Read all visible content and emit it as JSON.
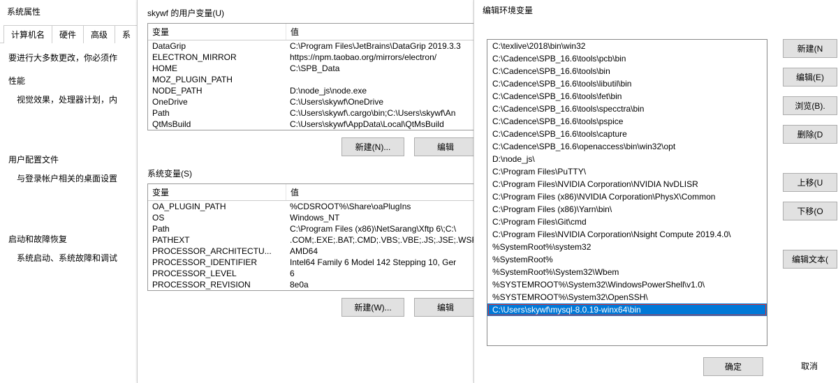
{
  "sysprops": {
    "title": "系统属性",
    "tabs": [
      "计算机名",
      "硬件",
      "高级",
      "系"
    ],
    "active_tab_index": 2,
    "content": {
      "line1": "要进行大多数更改，你必须作",
      "group1_label": "性能",
      "group1_desc": "视觉效果，处理器计划，内",
      "group2_label": "用户配置文件",
      "group2_desc": "与登录帐户相关的桌面设置",
      "group3_label": "启动和故障恢复",
      "group3_desc": "系统启动、系统故障和调试"
    }
  },
  "envvars": {
    "user_section_title": "skywf 的用户变量(U)",
    "sys_section_title": "系统变量(S)",
    "head_var": "变量",
    "head_val": "值",
    "user_vars": [
      {
        "var": "DataGrip",
        "val": "C:\\Program Files\\JetBrains\\DataGrip 2019.3.3"
      },
      {
        "var": "ELECTRON_MIRROR",
        "val": "https://npm.taobao.org/mirrors/electron/"
      },
      {
        "var": "HOME",
        "val": "C:\\SPB_Data"
      },
      {
        "var": "MOZ_PLUGIN_PATH",
        "val": ""
      },
      {
        "var": "NODE_PATH",
        "val": "D:\\node_js\\node.exe"
      },
      {
        "var": "OneDrive",
        "val": "C:\\Users\\skywf\\OneDrive"
      },
      {
        "var": "Path",
        "val": "C:\\Users\\skywf\\.cargo\\bin;C:\\Users\\skywf\\An"
      },
      {
        "var": "QtMsBuild",
        "val": "C:\\Users\\skywf\\AppData\\Local\\QtMsBuild"
      }
    ],
    "sys_vars": [
      {
        "var": "OA_PLUGIN_PATH",
        "val": "%CDSROOT%\\Share\\oaPlugIns"
      },
      {
        "var": "OS",
        "val": "Windows_NT"
      },
      {
        "var": "Path",
        "val": "C:\\Program Files (x86)\\NetSarang\\Xftp 6\\;C:\\"
      },
      {
        "var": "PATHEXT",
        "val": ".COM;.EXE;.BAT;.CMD;.VBS;.VBE;.JS;.JSE;.WSF"
      },
      {
        "var": "PROCESSOR_ARCHITECTU...",
        "val": "AMD64"
      },
      {
        "var": "PROCESSOR_IDENTIFIER",
        "val": "Intel64 Family 6 Model 142 Stepping 10, Ger"
      },
      {
        "var": "PROCESSOR_LEVEL",
        "val": "6"
      },
      {
        "var": "PROCESSOR_REVISION",
        "val": "8e0a"
      }
    ],
    "buttons": {
      "new_user": "新建(N)...",
      "edit_user": "编辑",
      "new_sys": "新建(W)...",
      "edit_sys": "编辑"
    }
  },
  "editvar": {
    "title": "编辑环境变量",
    "items": [
      "C:\\texlive\\2018\\bin\\win32",
      "C:\\Cadence\\SPB_16.6\\tools\\pcb\\bin",
      "C:\\Cadence\\SPB_16.6\\tools\\bin",
      "C:\\Cadence\\SPB_16.6\\tools\\libutil\\bin",
      "C:\\Cadence\\SPB_16.6\\tools\\fet\\bin",
      "C:\\Cadence\\SPB_16.6\\tools\\specctra\\bin",
      "C:\\Cadence\\SPB_16.6\\tools\\pspice",
      "C:\\Cadence\\SPB_16.6\\tools\\capture",
      "C:\\Cadence\\SPB_16.6\\openaccess\\bin\\win32\\opt",
      "D:\\node_js\\",
      "C:\\Program Files\\PuTTY\\",
      "C:\\Program Files\\NVIDIA Corporation\\NVIDIA NvDLISR",
      "C:\\Program Files (x86)\\NVIDIA Corporation\\PhysX\\Common",
      "C:\\Program Files (x86)\\Yarn\\bin\\",
      "C:\\Program Files\\Git\\cmd",
      "C:\\Program Files\\NVIDIA Corporation\\Nsight Compute 2019.4.0\\",
      "%SystemRoot%\\system32",
      "%SystemRoot%",
      "%SystemRoot%\\System32\\Wbem",
      "%SYSTEMROOT%\\System32\\WindowsPowerShell\\v1.0\\",
      "%SYSTEMROOT%\\System32\\OpenSSH\\",
      "C:\\Users\\skywf\\mysql-8.0.19-winx64\\bin"
    ],
    "selected_index": 21,
    "highlighted_index": 21,
    "buttons": {
      "new": "新建(N",
      "edit": "编辑(E)",
      "browse": "浏览(B).",
      "delete": "删除(D",
      "moveup": "上移(U",
      "movedown": "下移(O",
      "edittext": "编辑文本(",
      "ok": "确定",
      "cancel": "取消"
    }
  }
}
